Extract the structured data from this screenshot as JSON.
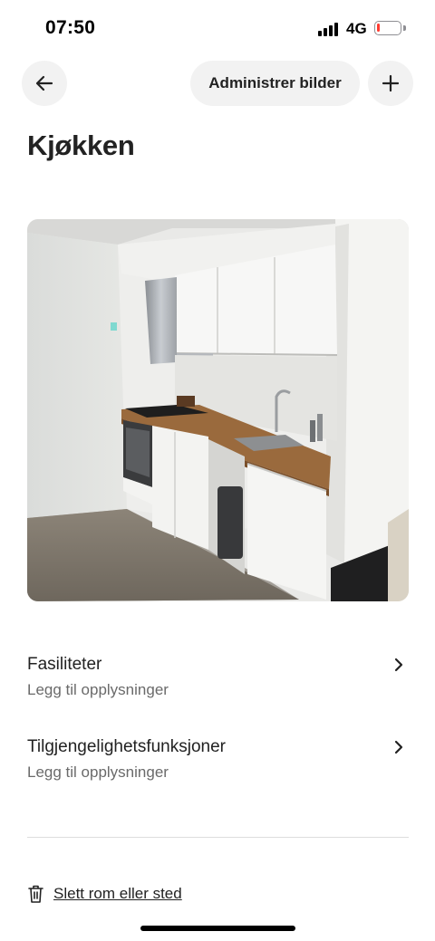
{
  "status_bar": {
    "time": "07:50",
    "network": "4G",
    "battery_level": 0.15,
    "battery_color": "#ff3b30"
  },
  "header": {
    "back_icon": "arrow-left-icon",
    "manage_label": "Administrer bilder",
    "add_icon": "plus-icon"
  },
  "page": {
    "title": "Kjøkken"
  },
  "sections": [
    {
      "title": "Fasiliteter",
      "subtitle": "Legg til opplysninger",
      "icon": "chevron-right-icon"
    },
    {
      "title": "Tilgjengelighetsfunksjoner",
      "subtitle": "Legg til opplysninger",
      "icon": "chevron-right-icon"
    }
  ],
  "delete": {
    "icon": "trash-icon",
    "label": "Slett rom eller sted"
  }
}
